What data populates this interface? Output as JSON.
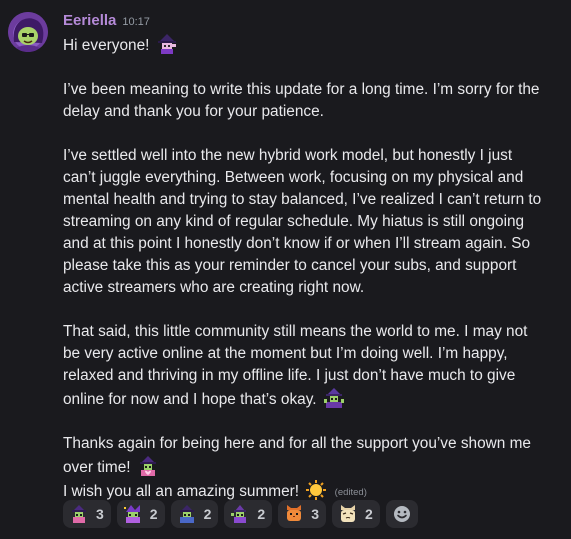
{
  "message": {
    "author": "Eeriella",
    "author_color": "#b58ad8",
    "timestamp": "10:17",
    "avatar_icon": "purple-witch-avatar",
    "lines": {
      "l1": "Hi everyone!",
      "l2": "I’ve been meaning to write this update for a long time. I’m sorry for the",
      "l3": "delay and thank you for your patience.",
      "l4": "I’ve settled well into the new hybrid work model, but honestly I just",
      "l5": "can’t juggle everything. Between work, focusing on my physical and",
      "l6": "mental health and trying to stay balanced, I’ve realized I can’t return to",
      "l7": "streaming on any kind of regular schedule. My hiatus is still ongoing",
      "l8": "and at this point I honestly don’t know if or when I’ll stream again. So",
      "l9": "please take this as your reminder to cancel your subs, and support",
      "l10": "active streamers who are creating right now.",
      "l11": "That said, this little community still means the world to me. I may not",
      "l12": "be very active online at the moment but I’m doing well. I’m happy,",
      "l13": "relaxed and thriving in my offline life. I just don’t have much to give",
      "l14": "online for now and I hope that’s okay.",
      "l15": "Thanks again for being here and for all the support you’ve shown me",
      "l16": "over time!",
      "l17": "I wish you all an amazing summer!"
    },
    "edited_label": "(edited)"
  },
  "inline_emojis": [
    "witch-wave-emoji",
    "witch-shrug-emoji",
    "witch-heart-emoji",
    "sun-emoji"
  ],
  "reactions": [
    {
      "icon": "witch-heart-emoji",
      "count": "3"
    },
    {
      "icon": "witch-party-emoji",
      "count": "2"
    },
    {
      "icon": "witch-hug-emoji",
      "count": "2"
    },
    {
      "icon": "witch-dance-emoji",
      "count": "2"
    },
    {
      "icon": "orange-cat-emoji",
      "count": "3"
    },
    {
      "icon": "cream-cat-emoji",
      "count": "2"
    }
  ],
  "add_reaction_icon": "add-reaction-smiley-icon",
  "colors": {
    "background": "#1a1a1e",
    "text": "#e9e9ec",
    "muted": "#949ba4",
    "reaction_bg": "#2b2b30"
  }
}
